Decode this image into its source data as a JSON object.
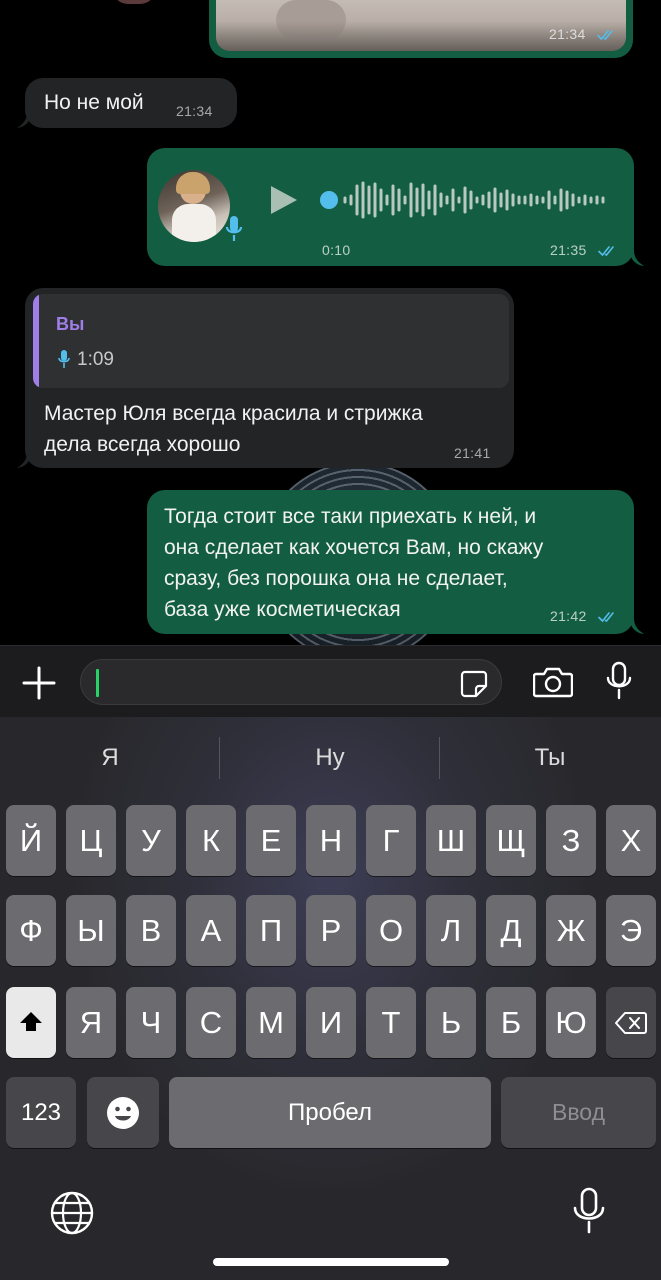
{
  "chat": {
    "msg_photo": {
      "time": "21:34"
    },
    "msg1": {
      "text": "Но не мой",
      "time": "21:34"
    },
    "voice": {
      "duration": "0:10",
      "time": "21:35"
    },
    "reply": {
      "quote_author": "Вы",
      "quote_voice_duration": "1:09",
      "line1": "Мастер Юля всегда красила и стрижка",
      "line2": "дела всегда хорошо",
      "time": "21:41"
    },
    "msg_out": {
      "line1": "Тогда стоит все таки приехать к ней, и",
      "line2": "она сделает как хочется  Вам, но скажу",
      "line3": "сразу, без порошка она не сделает,",
      "line4": "база уже косметическая",
      "time": "21:42"
    }
  },
  "input": {
    "value": ""
  },
  "keyboard": {
    "suggestions": [
      "Я",
      "Ну",
      "Ты"
    ],
    "row1": [
      "Й",
      "Ц",
      "У",
      "К",
      "Е",
      "Н",
      "Г",
      "Ш",
      "Щ",
      "З",
      "Х"
    ],
    "row2": [
      "Ф",
      "Ы",
      "В",
      "А",
      "П",
      "Р",
      "О",
      "Л",
      "Д",
      "Ж",
      "Э"
    ],
    "row3": [
      "Я",
      "Ч",
      "С",
      "М",
      "И",
      "Т",
      "Ь",
      "Б",
      "Ю"
    ],
    "numbers_label": "123",
    "space_label": "Пробел",
    "enter_label": "Ввод"
  },
  "colors": {
    "outgoing_bubble": "#135e43",
    "incoming_bubble": "#222425",
    "read_ticks": "#53bdeb",
    "accent_green": "#25d366",
    "quote_accent": "#a07ee8"
  }
}
